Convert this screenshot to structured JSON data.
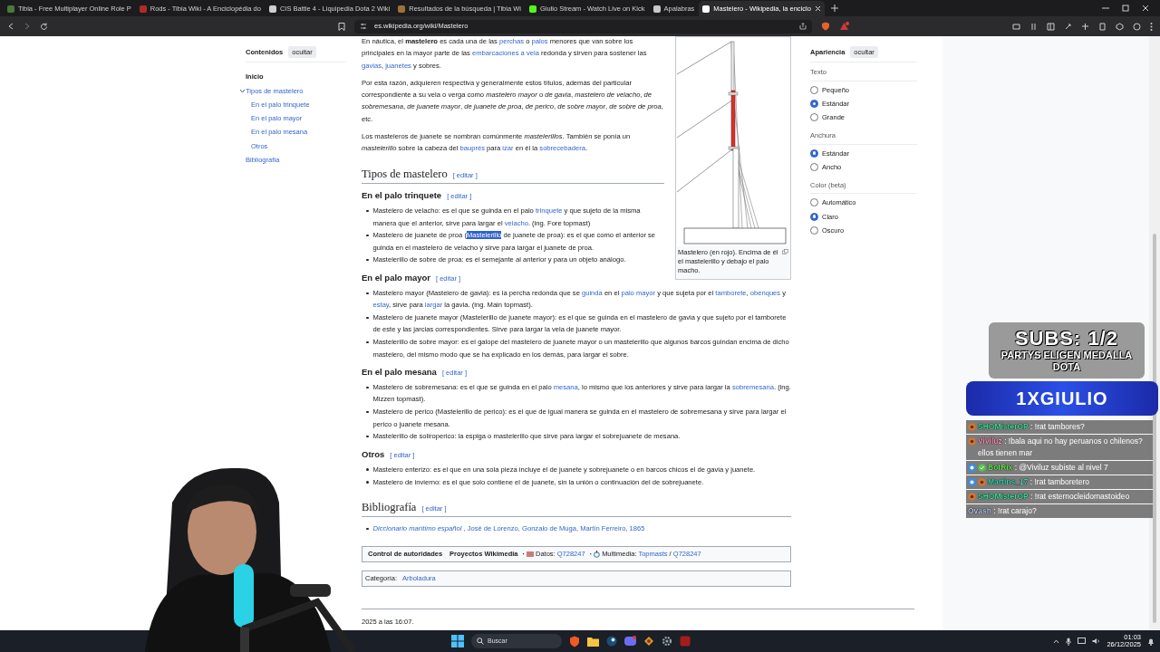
{
  "browser": {
    "tabs": [
      {
        "title": "Tibia - Free Multiplayer Online Role P",
        "selected": false,
        "color": "#4a7a3a"
      },
      {
        "title": "Rods - Tibia Wiki - A Enciclopédia do",
        "selected": false,
        "color": "#b02a2a"
      },
      {
        "title": "CIS Battle 4 - Liquipedia Dota 2 Wiki",
        "selected": false,
        "color": "#cfcfcf"
      },
      {
        "title": "Resultados de la búsqueda | Tibia Wi",
        "selected": false,
        "color": "#a0703a"
      },
      {
        "title": "Giulio Stream - Watch Live on Kick",
        "selected": false,
        "color": "#53fc18"
      },
      {
        "title": "Apalabras",
        "selected": false,
        "color": "#c8c8c8"
      },
      {
        "title": "Mastelero - Wikipedia, la enciclo",
        "selected": true,
        "color": "#ffffff"
      }
    ],
    "url": "es.wikipedia.org/wiki/Mastelero"
  },
  "toc": {
    "title": "Contenidos",
    "hide": "ocultar",
    "items": [
      {
        "label": "Inicio",
        "selected": true
      },
      {
        "label": "Tipos de mastelero",
        "selected": false,
        "expanded": true,
        "children": [
          {
            "label": "En el palo trinquete",
            "selected": false
          },
          {
            "label": "En el palo mayor",
            "selected": false
          },
          {
            "label": "En el palo mesana",
            "selected": false
          },
          {
            "label": "Otros",
            "selected": false
          }
        ]
      },
      {
        "label": "Bibliografía",
        "selected": false
      }
    ]
  },
  "figure": {
    "caption": "Mastelero (en rojo). Encima de él el mastelerillo y debajo el palo macho."
  },
  "article": [
    {
      "kind": "paragraph",
      "runs": [
        "En náutica, el ",
        {
          "kind": "strong",
          "text": "mastelero"
        },
        " es cada una de las ",
        {
          "kind": "link",
          "text": "perchas"
        },
        " o ",
        {
          "kind": "link",
          "text": "palos"
        },
        " menores que van sobre los principales en la mayor parte de las ",
        {
          "kind": "link",
          "text": "embarcaciones a vela"
        },
        " redonda y sirven para sostener las ",
        {
          "kind": "link",
          "text": "gavias"
        },
        ", ",
        {
          "kind": "link",
          "text": "juanetes"
        },
        " y sobres."
      ]
    },
    {
      "kind": "paragraph",
      "runs": [
        "Por esta razón, adquieren respectiva y generalmente estos títulos, además del particular correspondiente a su vela o verga como ",
        {
          "kind": "em",
          "text": "mastelero mayor"
        },
        " o ",
        {
          "kind": "em",
          "text": "de gavia"
        },
        ", ",
        {
          "kind": "em",
          "text": "mastelero de velacho"
        },
        ", ",
        {
          "kind": "em",
          "text": "de sobremesana"
        },
        ", ",
        {
          "kind": "em",
          "text": "de juanete mayor"
        },
        ", ",
        {
          "kind": "em",
          "text": "de juanete de proa"
        },
        ", ",
        {
          "kind": "em",
          "text": "de perico"
        },
        ", ",
        {
          "kind": "em",
          "text": "de sobre mayor"
        },
        ", ",
        {
          "kind": "em",
          "text": "de sobre de proa"
        },
        ", etc."
      ]
    },
    {
      "kind": "paragraph",
      "runs": [
        "Los masteleros de juanete se nombran comúnmente ",
        {
          "kind": "em",
          "text": "mastelerillos"
        },
        ". También se ponía un ",
        {
          "kind": "em",
          "text": "mastelerillo"
        },
        " sobre la cabeza del ",
        {
          "kind": "link",
          "text": "bauprés"
        },
        " para ",
        {
          "kind": "link",
          "text": "izar"
        },
        " en él la ",
        {
          "kind": "link",
          "text": "sobrecebadera"
        },
        "."
      ]
    },
    {
      "kind": "h2",
      "title": "Tipos de mastelero",
      "edit": "[ editar ]"
    },
    {
      "kind": "h3",
      "title": "En el palo trinquete",
      "edit": "[ editar ]"
    },
    {
      "kind": "list",
      "items": [
        [
          "Mastelero de velacho: es el que se guinda en el palo ",
          {
            "kind": "link",
            "text": "trinquete"
          },
          " y que sujeto de la misma manera que el anterior, sirve para largar el ",
          {
            "kind": "link",
            "text": "velacho"
          },
          ". (ing. Fore topmast)"
        ],
        [
          "Mastelero de juanete de proa (",
          {
            "kind": "selected",
            "text": "Mastelerillo"
          },
          " de juanete de proa): es el que como el anterior se guinda en el mastelero de velacho y sirve para largar el juanete de proa."
        ],
        [
          "Mastelerillo de sobre de proa: es el semejante al anterior y para un objeto análogo."
        ]
      ]
    },
    {
      "kind": "h3",
      "title": "En el palo mayor",
      "edit": "[ editar ]"
    },
    {
      "kind": "list",
      "items": [
        [
          "Mastelero mayor (Mastelero de gavia): es la percha redonda que se ",
          {
            "kind": "link",
            "text": "guinda"
          },
          " en el ",
          {
            "kind": "link",
            "text": "palo mayor"
          },
          " y que sujeta por el ",
          {
            "kind": "link",
            "text": "tamborete"
          },
          ", ",
          {
            "kind": "link",
            "text": "obenques"
          },
          " y ",
          {
            "kind": "link",
            "text": "estay"
          },
          ", sirve para ",
          {
            "kind": "link",
            "text": "largar"
          },
          " la gavia. (ing. Main topmast)."
        ],
        [
          "Mastelero de juanete mayor (Mastelerillo de juanete mayor): es el que se guinda en el mastelero de gavia y que sujeto por el tamborete de este y las jarcias correspondientes. Sirve para largar la vela de juanete mayor."
        ],
        [
          "Mastelerillo de sobre mayor: es el galope del mastelero de juanete mayor o un mastelerillo que algunos barcos guindan encima de dicho mastelero, del mismo modo que se ha explicado en los demás, para largar el sobre."
        ]
      ]
    },
    {
      "kind": "h3",
      "title": "En el palo mesana",
      "edit": "[ editar ]"
    },
    {
      "kind": "list",
      "items": [
        [
          "Mastelero de sobremesana: es el que se guinda en el palo ",
          {
            "kind": "link",
            "text": "mesana"
          },
          ", lo mismo que los anteriores y sirve para largar la ",
          {
            "kind": "link",
            "text": "sobremesana"
          },
          ". (ing. Mizzen topmast)."
        ],
        [
          "Mastelero de perico (Mastelerillo de perico): es el que de igual manera se guinda en el mastelero de sobremesana y sirve para largar el perico o juanete mesana."
        ],
        [
          "Mastelerillo de soliroperico: la espiga o mastelerillo que sirve para largar el sobrejuanete de mesana."
        ]
      ]
    },
    {
      "kind": "h3",
      "title": "Otros",
      "edit": "[ editar ]"
    },
    {
      "kind": "list",
      "items": [
        [
          "Mastelero enterizo: es el que en una sola pieza incluye el de juanete y sobrejuanete o en barcos chicos el de gavia y juanete."
        ],
        [
          "Mastelero de invierno: es el que solo contiene el de juanete, sin la unión o continuación del de sobrejuanete."
        ]
      ]
    },
    {
      "kind": "h2",
      "title": "Bibliografía",
      "edit": "[ editar ]"
    },
    {
      "kind": "list",
      "items": [
        [
          {
            "kind": "link_em",
            "text": "Diccionario marítimo español"
          },
          {
            "kind": "external",
            "text": ", José de Lorenzo, Gonzalo de Muga, Martín Ferreiro, 1865"
          }
        ]
      ]
    }
  ],
  "authority_control": {
    "title": "Control de autoridades",
    "project": "Proyectos Wikimedia",
    "entries": [
      {
        "kind": "data",
        "separator": "·",
        "runs": [
          "Datos: ",
          {
            "kind": "link",
            "text": "Q728247"
          }
        ]
      },
      {
        "kind": "media",
        "separator": "·",
        "runs": [
          "Multimedia: ",
          {
            "kind": "link",
            "text": "Topmasts"
          },
          " / ",
          {
            "kind": "link",
            "text": "Q728247"
          }
        ]
      }
    ]
  },
  "categories": {
    "label": "Categoría:",
    "links": [
      "Arboladura"
    ]
  },
  "footer": "2025 a las 16:07.",
  "appearance": {
    "title": "Apariencia",
    "hide": "ocultar",
    "groups": [
      {
        "label": "Texto",
        "options": [
          {
            "label": "Pequeño",
            "selected": false
          },
          {
            "label": "Estándar",
            "selected": true
          },
          {
            "label": "Grande",
            "selected": false
          }
        ]
      },
      {
        "label": "Anchura",
        "options": [
          {
            "label": "Estándar",
            "selected": true
          },
          {
            "label": "Ancho",
            "selected": false
          }
        ]
      },
      {
        "label": "Color (beta)",
        "options": [
          {
            "label": "Automático",
            "selected": false
          },
          {
            "label": "Claro",
            "selected": true
          },
          {
            "label": "Oscuro",
            "selected": false
          }
        ]
      }
    ]
  },
  "stream": {
    "goal_title": "SUBS: 1/2",
    "goal_subtitle": "PARTYS ELIGEN MEDALLA DOTA",
    "banner": "1XGIULIO",
    "chat": [
      {
        "kind": "sub",
        "user": "SHOMisterOP",
        "color": "#3ddc97",
        "text": ": !rat tambores?"
      },
      {
        "kind": "sub",
        "user": "Viviluz",
        "color": "#ff8fb8",
        "text": ": !bala aqui no hay peruanos o chilenos? ellos tienen mar"
      },
      {
        "kind": "verifiedbot",
        "user": "BotRix",
        "color": "#5ce04a",
        "text": ": @Viviluz subiste al nivel 7"
      },
      {
        "kind": "botsub",
        "user": "Martins_17",
        "color": "#3fd0b0",
        "text": ": !rat tamboretero"
      },
      {
        "kind": "sub",
        "user": "SHOMisterOP",
        "color": "#3ddc97",
        "text": ": !rat esternocleidomastoideo"
      },
      {
        "kind": "plain",
        "user": "Ovash",
        "color": "#b8c4e8",
        "text": ": !rat carajo?"
      }
    ]
  },
  "taskbar": {
    "search": "Buscar",
    "time": "01:03",
    "date": "26/12/2025"
  }
}
